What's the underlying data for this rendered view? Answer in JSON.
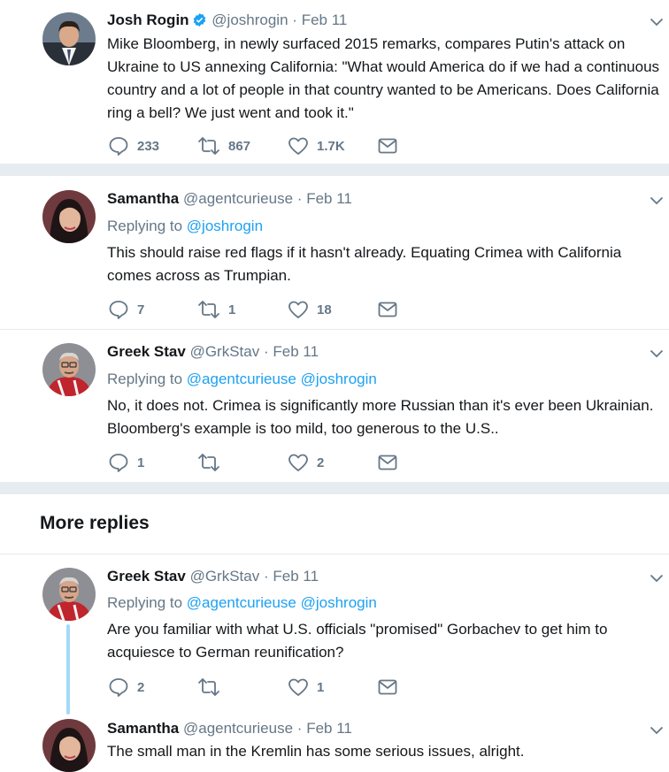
{
  "tweets": [
    {
      "name": "Josh Rogin",
      "handle": "@joshrogin",
      "separator": "·",
      "time": "Feb 11",
      "verified": true,
      "text": "Mike Bloomberg, in newly surfaced 2015 remarks, compares Putin's attack on Ukraine to US annexing California: \"What would America do if we had a continuous country and a lot of people in that country wanted to be Americans. Does California ring a bell? We just went and took it.\"",
      "replies": "233",
      "retweets": "867",
      "likes": "1.7K"
    },
    {
      "name": "Samantha",
      "handle": "@agentcurieuse",
      "separator": "·",
      "time": "Feb 11",
      "replying_label": "Replying to",
      "replying_to": [
        "@joshrogin"
      ],
      "text": "This should raise red flags if it hasn't already. Equating Crimea with California comes across as Trumpian.",
      "replies": "7",
      "retweets": "1",
      "likes": "18"
    },
    {
      "name": "Greek Stav",
      "handle": "@GrkStav",
      "separator": "·",
      "time": "Feb 11",
      "replying_label": "Replying to",
      "replying_to": [
        "@agentcurieuse",
        "@joshrogin"
      ],
      "text": "No, it does not. Crimea is significantly more Russian than it's ever been Ukrainian. Bloomberg's example is too mild, too generous to the U.S..",
      "replies": "1",
      "retweets": "",
      "likes": "2"
    },
    {
      "name": "Greek Stav",
      "handle": "@GrkStav",
      "separator": "·",
      "time": "Feb 11",
      "replying_label": "Replying to",
      "replying_to": [
        "@agentcurieuse",
        "@joshrogin"
      ],
      "text": "Are you familiar with what U.S. officials \"promised\" Gorbachev to get him to acquiesce to German reunification?",
      "replies": "2",
      "retweets": "",
      "likes": "1"
    },
    {
      "name": "Samantha",
      "handle": "@agentcurieuse",
      "separator": "·",
      "time": "Feb 11",
      "text": "The small man in the Kremlin has some serious issues, alright."
    }
  ],
  "more_replies_title": "More replies",
  "icons": {
    "reply": "reply-icon",
    "retweet": "retweet-icon",
    "like": "heart-icon",
    "dm": "envelope-icon",
    "caret": "chevron-down-icon",
    "verified": "verified-badge-icon"
  },
  "colors": {
    "link": "#1da1f2",
    "secondary_text": "#657786",
    "separator": "#e6ecf0",
    "thread_line": "#a4d9f9"
  }
}
